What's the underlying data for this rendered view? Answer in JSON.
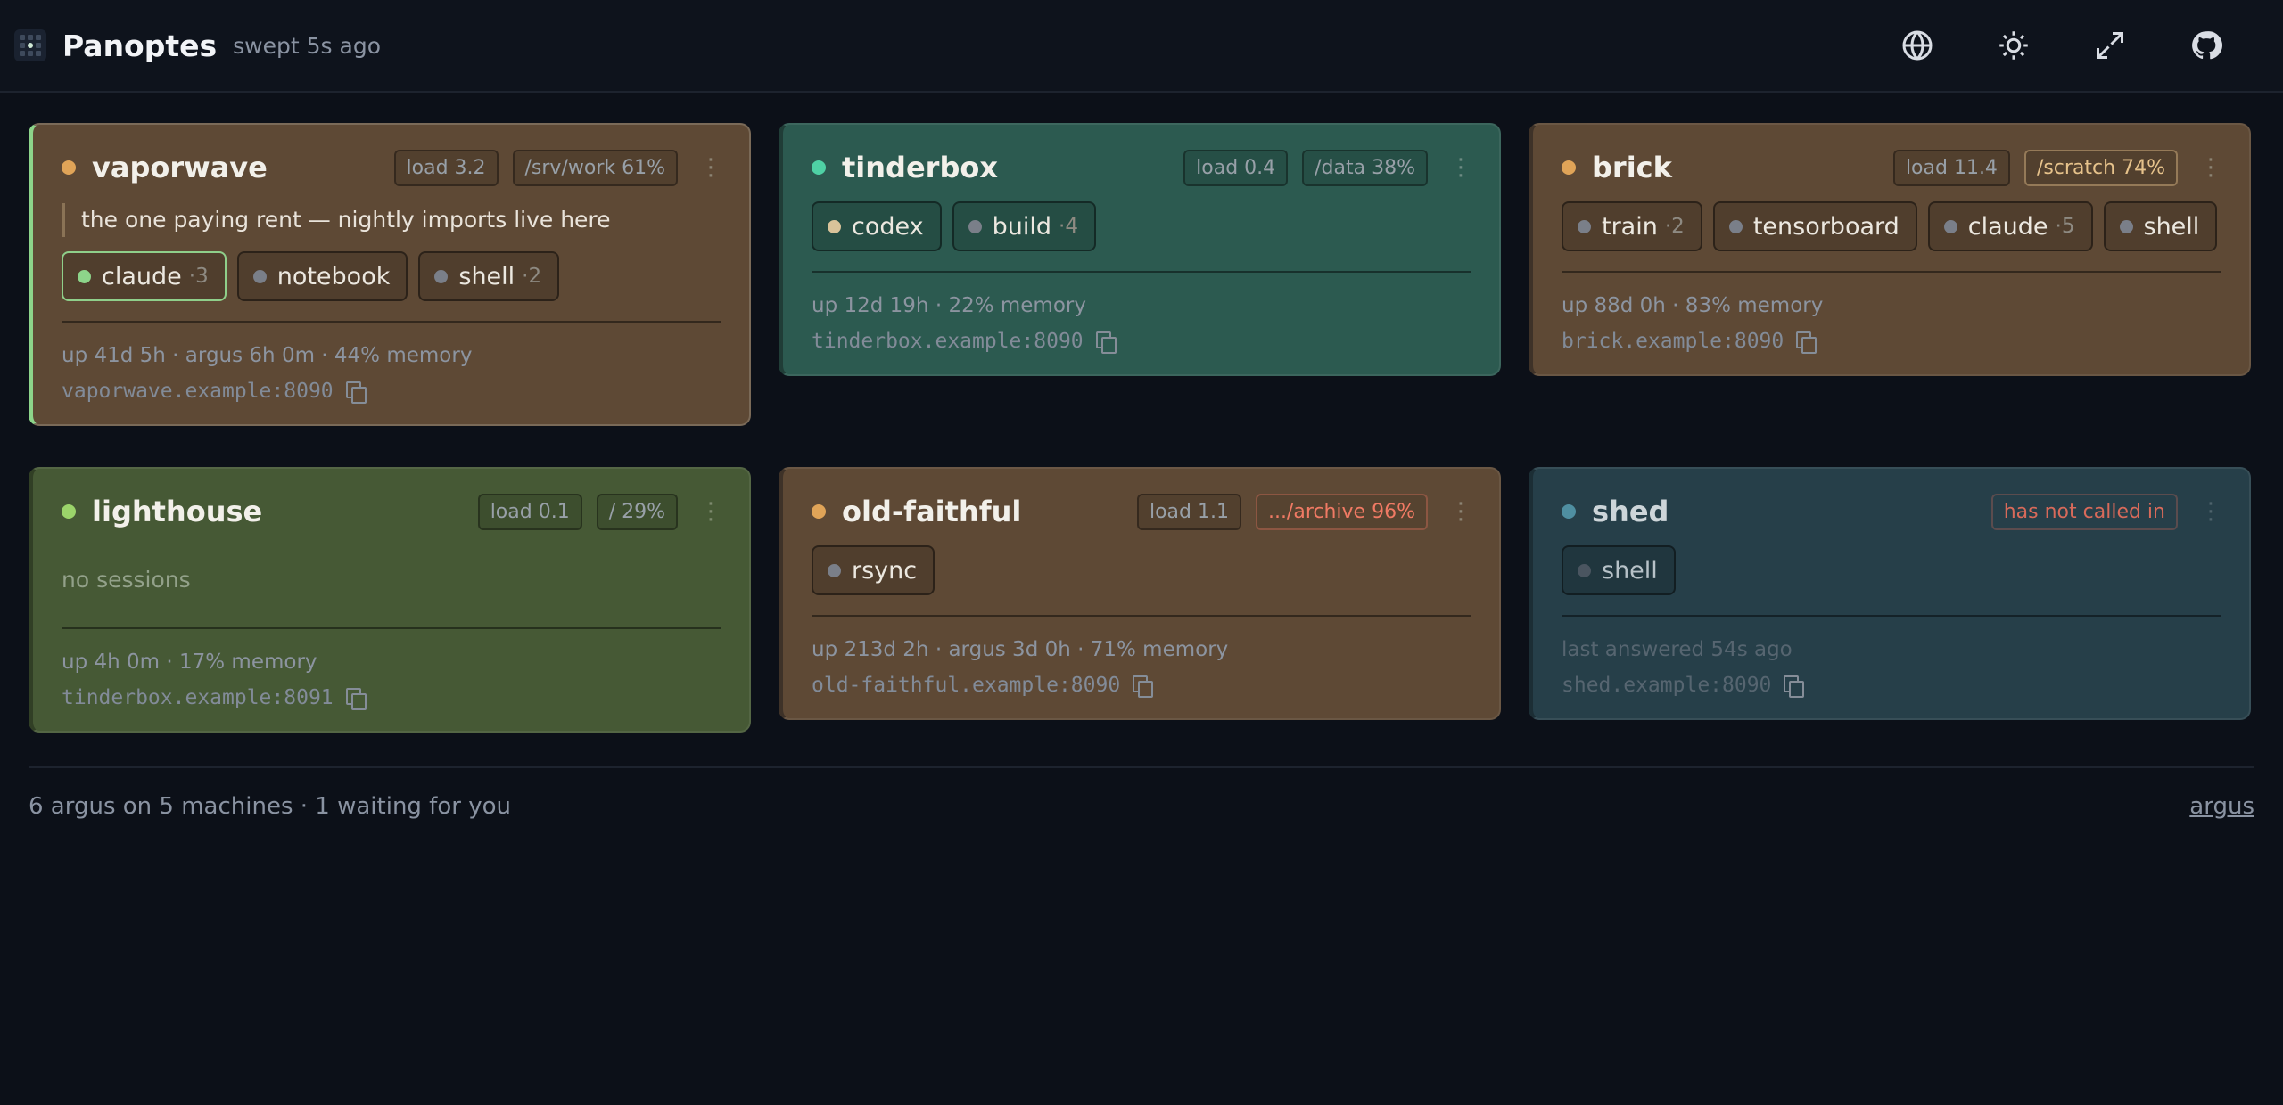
{
  "app": {
    "title": "Panoptes",
    "subtitle": "swept 5s ago"
  },
  "toolbar": {
    "icons": [
      "globe-icon",
      "sun-icon",
      "expand-icon",
      "github-icon"
    ]
  },
  "colors": {
    "green": "#8dd48a",
    "amber": "#e0a458",
    "teal": "#4fd1a5",
    "slate": "#4f8fa1",
    "grey": "#7a7f89",
    "tan": "#d9c39a",
    "red": "#f07a64"
  },
  "machines": [
    {
      "name": "vaporwave",
      "status_color": "#e0a458",
      "load": "load 3.2",
      "disk": "/srv/work 61%",
      "note": "the one paying rent — nightly imports live here",
      "sessions": [
        {
          "label": "claude",
          "count": "·3",
          "dot": "#8dd48a"
        },
        {
          "label": "notebook",
          "count": "",
          "dot": "#7a7f89"
        },
        {
          "label": "shell",
          "count": "·2",
          "dot": "#7a7f89"
        }
      ],
      "meta": "up 41d 5h · argus 6h 0m · 44% memory",
      "address": "vaporwave.example:8090"
    },
    {
      "name": "tinderbox",
      "status_color": "#4fd1a5",
      "load": "load 0.4",
      "disk": "/data 38%",
      "sessions": [
        {
          "label": "codex",
          "count": "",
          "dot": "#d9c39a"
        },
        {
          "label": "build",
          "count": "·4",
          "dot": "#7a7f89"
        }
      ],
      "meta": "up 12d 19h · 22% memory",
      "address": "tinderbox.example:8090"
    },
    {
      "name": "brick",
      "status_color": "#e0a458",
      "load": "load 11.4",
      "disk": "/scratch 74%",
      "sessions": [
        {
          "label": "train",
          "count": "·2",
          "dot": "#7a7f89"
        },
        {
          "label": "tensorboard",
          "count": "",
          "dot": "#7a7f89"
        },
        {
          "label": "claude",
          "count": "·5",
          "dot": "#7a7f89"
        },
        {
          "label": "shell",
          "count": "",
          "dot": "#7a7f89"
        }
      ],
      "meta": "up 88d 0h · 83% memory",
      "address": "brick.example:8090"
    },
    {
      "name": "lighthouse",
      "status_color": "#9bd46a",
      "load": "load 0.1",
      "disk": "/ 29%",
      "empty": "no sessions",
      "meta": "up 4h 0m · 17% memory",
      "address": "tinderbox.example:8091"
    },
    {
      "name": "old-faithful",
      "status_color": "#e0a458",
      "load": "load 1.1",
      "disk": ".../archive 96%",
      "sessions": [
        {
          "label": "rsync",
          "count": "",
          "dot": "#7a7f89"
        }
      ],
      "meta": "up 213d 2h · argus 3d 0h · 71% memory",
      "address": "old-faithful.example:8090"
    },
    {
      "name": "shed",
      "status_color": "#4f8fa1",
      "status": "has not called in",
      "sessions": [
        {
          "label": "shell",
          "count": "",
          "dot": "#4a5560"
        }
      ],
      "meta": "last answered 54s ago",
      "address": "shed.example:8090"
    }
  ],
  "footer": {
    "summary": "6 argus on 5 machines · 1 waiting for you",
    "link": "argus"
  }
}
